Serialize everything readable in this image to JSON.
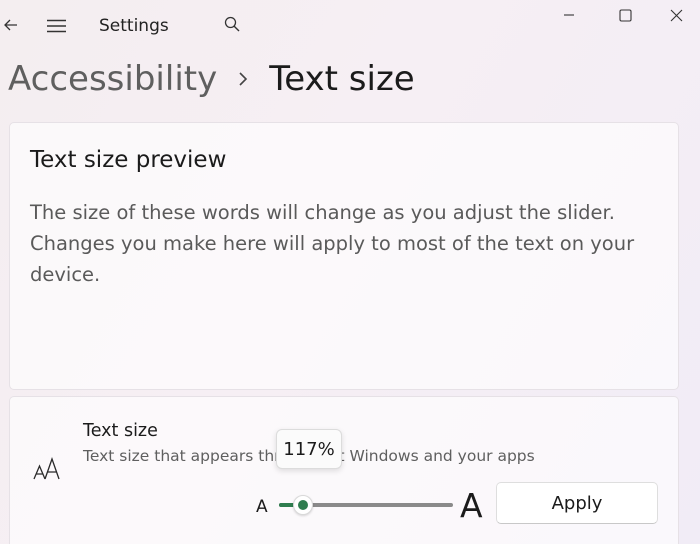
{
  "window": {
    "title": "Settings",
    "back_icon": "back-arrow-icon",
    "menu_icon": "hamburger-menu-icon",
    "search_icon": "search-icon",
    "controls": [
      "minimize-icon",
      "maximize-icon",
      "close-icon"
    ]
  },
  "breadcrumb": {
    "parent": "Accessibility",
    "separator_icon": "chevron-right-icon",
    "current": "Text size"
  },
  "preview": {
    "title": "Text size preview",
    "body": "The size of these words will change as you adjust the slider. Changes you make here will apply to most of the text on your device."
  },
  "text_size_setting": {
    "icon": "text-size-icon",
    "title": "Text size",
    "description": "Text size that appears throughout Windows and your apps",
    "slider": {
      "min_label": "A",
      "max_label": "A",
      "min": 100,
      "max": 225,
      "value": 117,
      "tooltip": "117%"
    },
    "apply_label": "Apply"
  },
  "colors": {
    "accent": "#2f7d4f",
    "track": "#8a8a8a"
  }
}
